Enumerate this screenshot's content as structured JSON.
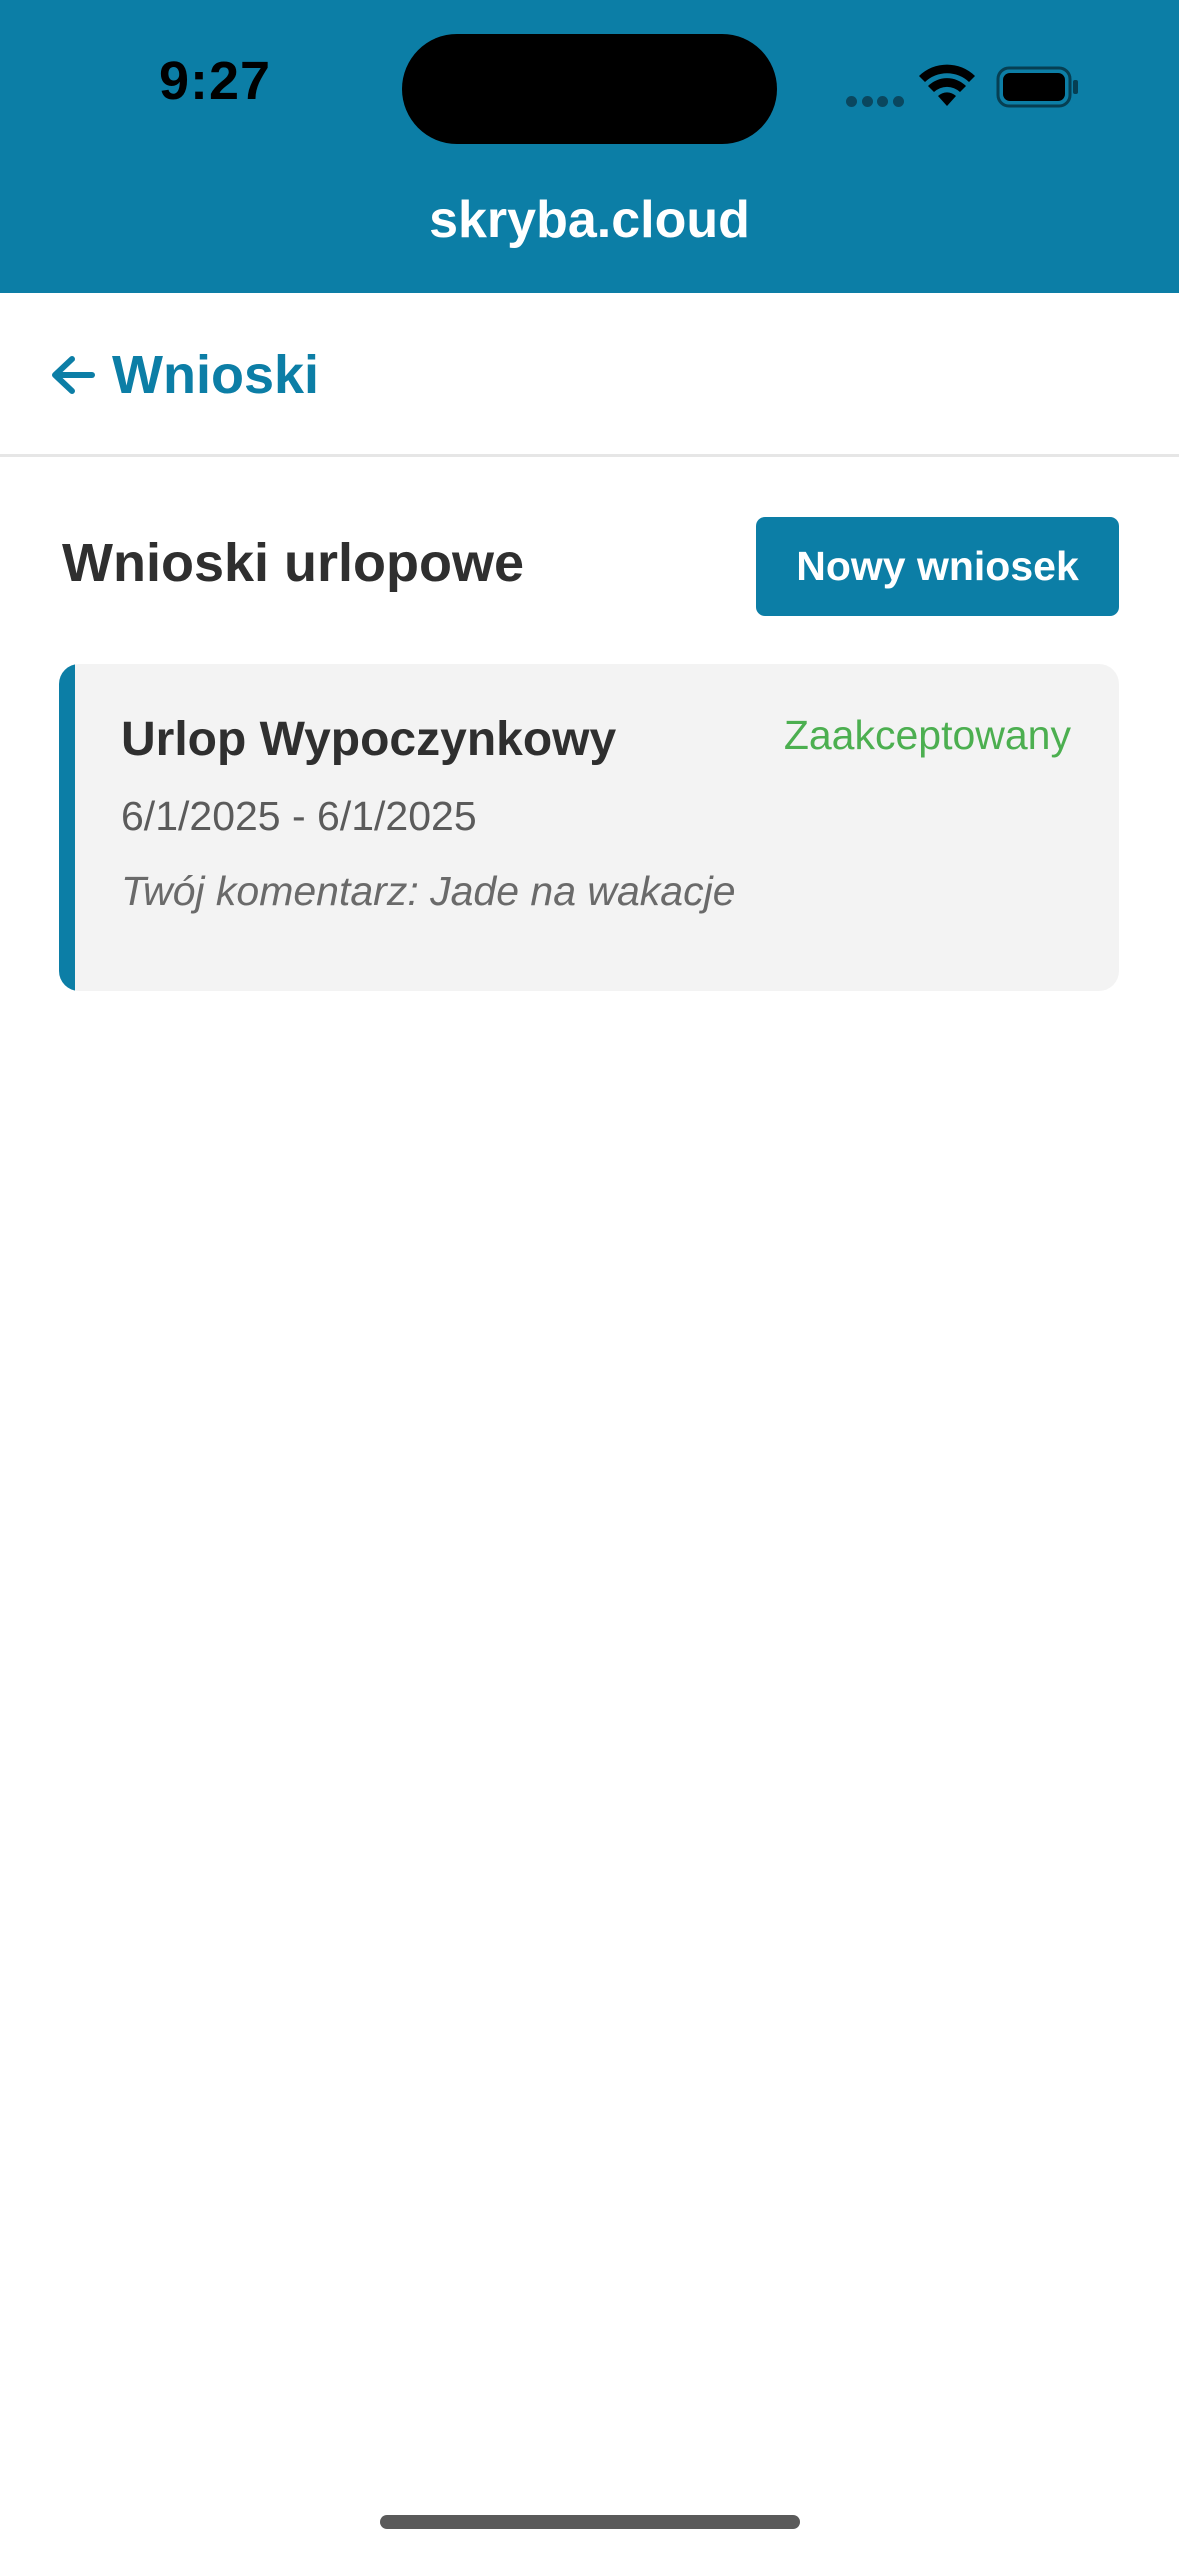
{
  "status_bar": {
    "time": "9:27"
  },
  "app": {
    "title": "skryba.cloud",
    "accent_color": "#0c7ea6",
    "status_accepted_color": "#4caf50"
  },
  "nav": {
    "back_label": "Wnioski",
    "back_icon": "arrow-left-icon"
  },
  "section": {
    "title": "Wnioski urlopowe",
    "new_button_label": "Nowy wniosek"
  },
  "requests": [
    {
      "type": "Urlop Wypoczynkowy",
      "status": "Zaakceptowany",
      "dates": "6/1/2025 - 6/1/2025",
      "comment": "Twój komentarz: Jade na wakacje"
    }
  ]
}
